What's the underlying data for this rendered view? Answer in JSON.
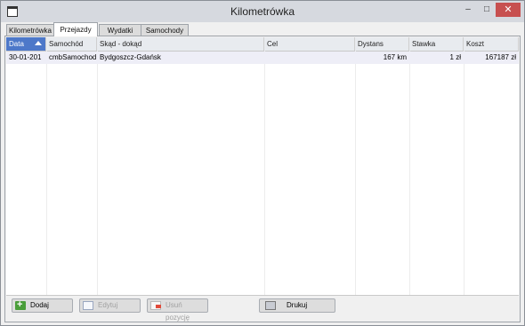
{
  "window": {
    "title": "Kilometrówka",
    "minimize": "–",
    "maximize": "□",
    "close": "✕"
  },
  "tabs": [
    {
      "label": "Kilometrówka"
    },
    {
      "label": "Przejazdy"
    },
    {
      "label": "Wydatki"
    },
    {
      "label": "Samochody"
    }
  ],
  "table": {
    "columns": [
      {
        "label": "Data"
      },
      {
        "label": "Samochód"
      },
      {
        "label": "Skąd - dokąd"
      },
      {
        "label": "Cel"
      },
      {
        "label": "Dystans"
      },
      {
        "label": "Stawka"
      },
      {
        "label": "Koszt"
      }
    ],
    "rows": [
      {
        "data": "30-01-201",
        "samochod": "cmbSamochod",
        "skad": "Bydgoszcz-Gdańsk",
        "cel": "",
        "dystans": "167 km",
        "stawka": "1 zł",
        "koszt": "167187 zł"
      }
    ]
  },
  "buttons": {
    "add": "Dodaj",
    "edit": "Edytuj",
    "delete": "Usuń pozycję",
    "print": "Drukuj"
  }
}
